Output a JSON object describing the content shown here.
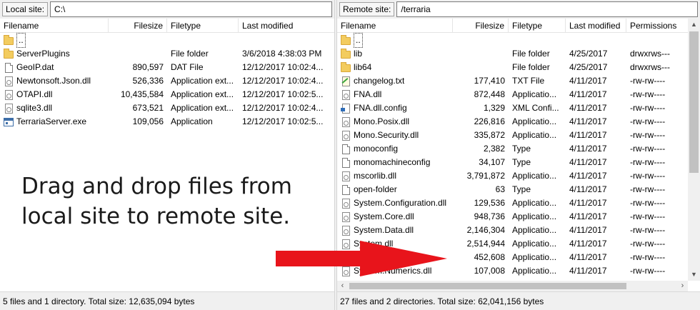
{
  "local": {
    "site_label": "Local site:",
    "path": "C:\\",
    "columns": [
      "Filename",
      "Filesize",
      "Filetype",
      "Last modified"
    ],
    "rows": [
      {
        "icon": "folder-icon",
        "name": "..",
        "size": "",
        "type": "",
        "modified": ""
      },
      {
        "icon": "folder-icon",
        "name": "ServerPlugins",
        "size": "",
        "type": "File folder",
        "modified": "3/6/2018 4:38:03 PM"
      },
      {
        "icon": "file-icon",
        "name": "GeoIP.dat",
        "size": "890,597",
        "type": "DAT File",
        "modified": "12/12/2017 10:02:4..."
      },
      {
        "icon": "dll-icon",
        "name": "Newtonsoft.Json.dll",
        "size": "526,336",
        "type": "Application ext...",
        "modified": "12/12/2017 10:02:4..."
      },
      {
        "icon": "dll-icon",
        "name": "OTAPI.dll",
        "size": "10,435,584",
        "type": "Application ext...",
        "modified": "12/12/2017 10:02:5..."
      },
      {
        "icon": "dll-icon",
        "name": "sqlite3.dll",
        "size": "673,521",
        "type": "Application ext...",
        "modified": "12/12/2017 10:02:4..."
      },
      {
        "icon": "exe-icon",
        "name": "TerrariaServer.exe",
        "size": "109,056",
        "type": "Application",
        "modified": "12/12/2017 10:02:5..."
      }
    ],
    "status": "5 files and 1 directory. Total size: 12,635,094 bytes"
  },
  "remote": {
    "site_label": "Remote site:",
    "path": "/terraria",
    "columns": [
      "Filename",
      "Filesize",
      "Filetype",
      "Last modified",
      "Permissions"
    ],
    "rows": [
      {
        "icon": "folder-icon",
        "name": "..",
        "size": "",
        "type": "",
        "modified": "",
        "perms": ""
      },
      {
        "icon": "folder-icon",
        "name": "lib",
        "size": "",
        "type": "File folder",
        "modified": "4/25/2017",
        "perms": "drwxrws---"
      },
      {
        "icon": "folder-icon",
        "name": "lib64",
        "size": "",
        "type": "File folder",
        "modified": "4/25/2017",
        "perms": "drwxrws---"
      },
      {
        "icon": "txt-icon",
        "name": "changelog.txt",
        "size": "177,410",
        "type": "TXT File",
        "modified": "4/11/2017",
        "perms": "-rw-rw----"
      },
      {
        "icon": "dll-icon",
        "name": "FNA.dll",
        "size": "872,448",
        "type": "Applicatio...",
        "modified": "4/11/2017",
        "perms": "-rw-rw----"
      },
      {
        "icon": "config-icon",
        "name": "FNA.dll.config",
        "size": "1,329",
        "type": "XML Confi...",
        "modified": "4/11/2017",
        "perms": "-rw-rw----"
      },
      {
        "icon": "dll-icon",
        "name": "Mono.Posix.dll",
        "size": "226,816",
        "type": "Applicatio...",
        "modified": "4/11/2017",
        "perms": "-rw-rw----"
      },
      {
        "icon": "dll-icon",
        "name": "Mono.Security.dll",
        "size": "335,872",
        "type": "Applicatio...",
        "modified": "4/11/2017",
        "perms": "-rw-rw----"
      },
      {
        "icon": "file-icon",
        "name": "monoconfig",
        "size": "2,382",
        "type": "Type",
        "modified": "4/11/2017",
        "perms": "-rw-rw----"
      },
      {
        "icon": "file-icon",
        "name": "monomachineconfig",
        "size": "34,107",
        "type": "Type",
        "modified": "4/11/2017",
        "perms": "-rw-rw----"
      },
      {
        "icon": "dll-icon",
        "name": "mscorlib.dll",
        "size": "3,791,872",
        "type": "Applicatio...",
        "modified": "4/11/2017",
        "perms": "-rw-rw----"
      },
      {
        "icon": "file-icon",
        "name": "open-folder",
        "size": "63",
        "type": "Type",
        "modified": "4/11/2017",
        "perms": "-rw-rw----"
      },
      {
        "icon": "dll-icon",
        "name": "System.Configuration.dll",
        "size": "129,536",
        "type": "Applicatio...",
        "modified": "4/11/2017",
        "perms": "-rw-rw----"
      },
      {
        "icon": "dll-icon",
        "name": "System.Core.dll",
        "size": "948,736",
        "type": "Applicatio...",
        "modified": "4/11/2017",
        "perms": "-rw-rw----"
      },
      {
        "icon": "dll-icon",
        "name": "System.Data.dll",
        "size": "2,146,304",
        "type": "Applicatio...",
        "modified": "4/11/2017",
        "perms": "-rw-rw----"
      },
      {
        "icon": "dll-icon",
        "name": "System.dll",
        "size": "2,514,944",
        "type": "Applicatio...",
        "modified": "4/11/2017",
        "perms": "-rw-rw----"
      },
      {
        "icon": "dll-icon",
        "name": "",
        "size": "452,608",
        "type": "Applicatio...",
        "modified": "4/11/2017",
        "perms": "-rw-rw----"
      },
      {
        "icon": "dll-icon",
        "name": "System.Numerics.dll",
        "size": "107,008",
        "type": "Applicatio...",
        "modified": "4/11/2017",
        "perms": "-rw-rw----"
      }
    ],
    "status": "27 files and 2 directories. Total size: 62,041,156 bytes"
  },
  "overlay": {
    "line1": "Drag and drop files from",
    "line2": "local site to remote site."
  },
  "colors": {
    "arrow": "#e8141b",
    "panel_bg": "#f0f0f0",
    "folder": "#f3cc5f"
  }
}
